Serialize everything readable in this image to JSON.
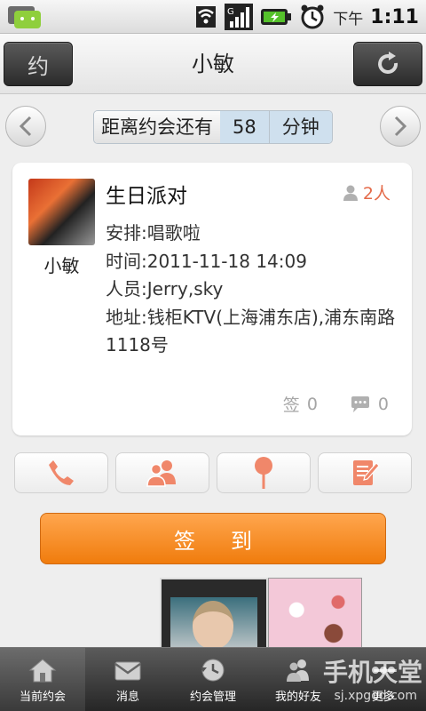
{
  "status_bar": {
    "time_label": "下午",
    "time": "1:11",
    "icons": [
      "message-notification-icon",
      "wifi-icon",
      "signal-icon",
      "battery-charging-icon",
      "alarm-icon"
    ]
  },
  "header": {
    "left_button_label": "约",
    "title": "小敏",
    "right_button_icon": "refresh-icon"
  },
  "countdown": {
    "prefix": "距离约会还有",
    "value": "58",
    "unit": "分钟"
  },
  "event": {
    "host_name": "小敏",
    "title": "生日派对",
    "people_count": "2人",
    "details": [
      "安排:唱歌啦",
      "时间:2011-11-18 14:09",
      "人员:Jerry,sky",
      "地址:钱柜KTV(上海浦东店),浦东南路1118号"
    ],
    "sign_label": "签",
    "sign_count": "0",
    "comment_count": "0"
  },
  "actions": [
    "phone-icon",
    "contacts-icon",
    "location-pin-icon",
    "edit-note-icon"
  ],
  "checkin_label": "签到",
  "tabs": [
    {
      "label": "当前约会",
      "icon": "home-icon"
    },
    {
      "label": "消息",
      "icon": "mail-icon"
    },
    {
      "label": "约会管理",
      "icon": "history-icon"
    },
    {
      "label": "我的好友",
      "icon": "friends-icon"
    },
    {
      "label": "更多",
      "icon": "more-icon"
    }
  ],
  "watermark": {
    "text": "手机天堂",
    "url": "sj.xpgod.com"
  },
  "colors": {
    "accent_orange": "#f07c0d",
    "people_count": "#e46b4a",
    "icon_salmon": "#f0876a"
  }
}
